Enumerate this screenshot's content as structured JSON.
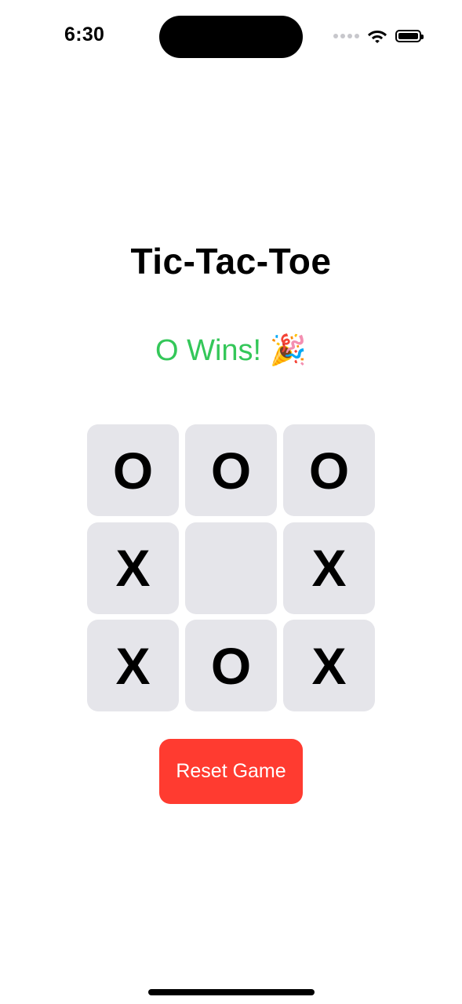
{
  "status_bar": {
    "time": "6:30",
    "signal": "signal-dots-icon",
    "wifi": "wifi-icon",
    "battery": "battery-icon"
  },
  "game": {
    "title": "Tic-Tac-Toe",
    "status_text": "O Wins! 🎉",
    "status_color": "#34c759",
    "board": [
      [
        "O",
        "O",
        "O"
      ],
      [
        "X",
        "",
        "X"
      ],
      [
        "X",
        "O",
        "X"
      ]
    ],
    "reset_label": "Reset Game",
    "reset_color": "#ff3b30",
    "cell_color": "#e5e5ea"
  }
}
